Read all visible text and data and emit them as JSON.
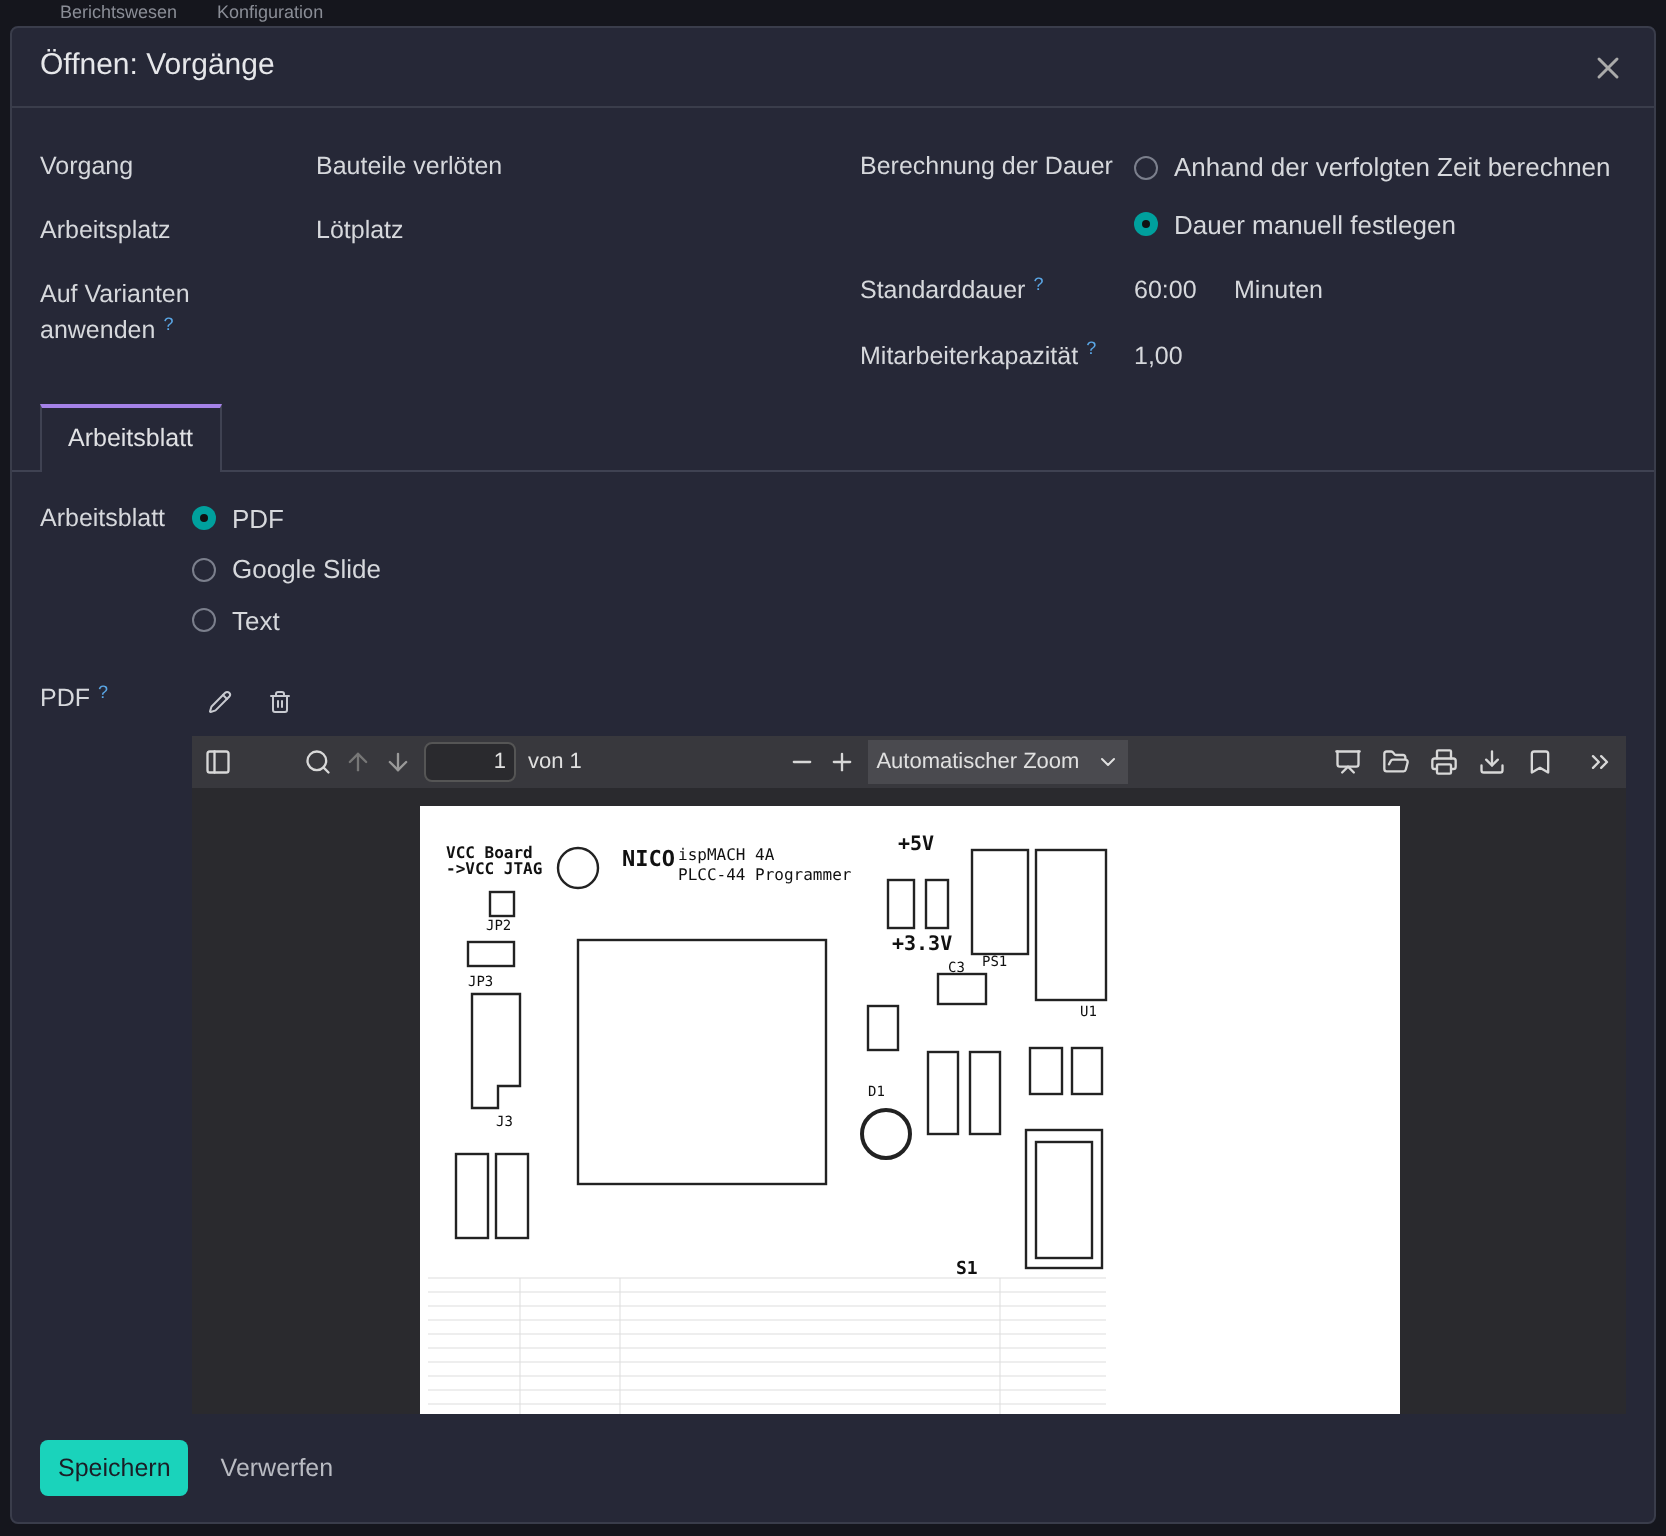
{
  "background_nav": [
    "Berichtswesen",
    "Konfiguration"
  ],
  "dialog": {
    "title": "Öffnen: Vorgänge"
  },
  "fields_left": [
    {
      "label": "Vorgang",
      "value": "Bauteile verlöten"
    },
    {
      "label": "Arbeitsplatz",
      "value": "Lötplatz"
    },
    {
      "label": "Auf Varianten anwenden",
      "help_mark": "?"
    }
  ],
  "duration_calc": {
    "label": "Berechnung der Dauer",
    "options": [
      {
        "label": "Anhand der verfolgten Zeit berechnen",
        "selected": false
      },
      {
        "label": "Dauer manuell festlegen",
        "selected": true
      }
    ]
  },
  "standard_duration": {
    "label": "Standarddauer",
    "help_mark": "?",
    "value": "60:00",
    "unit": "Minuten"
  },
  "capacity": {
    "label": "Mitarbeiterkapazität",
    "help_mark": "?",
    "value": "1,00"
  },
  "tabs": [
    {
      "label": "Arbeitsblatt",
      "selected": true
    }
  ],
  "worksheet": {
    "label": "Arbeitsblatt",
    "options": [
      {
        "label": "PDF",
        "selected": true
      },
      {
        "label": "Google Slide",
        "selected": false
      },
      {
        "label": "Text",
        "selected": false
      }
    ]
  },
  "pdf": {
    "label": "PDF",
    "help_mark": "?"
  },
  "pdf_viewer": {
    "page": "1",
    "page_count": "von 1",
    "zoom": "Automatischer Zoom",
    "page_labels": [
      "VCC Board",
      "->VCC JTAG",
      "NICO",
      "ispMACH 4A",
      "PLCC-44 Programmer",
      "+5V",
      "+3.3V",
      "JP2",
      "JP3",
      "J3",
      "C3",
      "PS1",
      "U1",
      "D1",
      "S1"
    ]
  },
  "buttons": [
    {
      "label": "Speichern",
      "kind": "primary"
    },
    {
      "label": "Verwerfen",
      "kind": "secondary"
    }
  ]
}
